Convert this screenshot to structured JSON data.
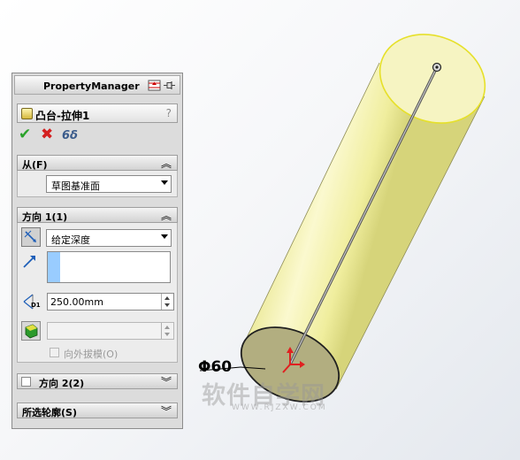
{
  "property_manager": {
    "title": "PropertyManager",
    "feature_name": "凸台-拉伸1",
    "help": "?",
    "actions": {
      "ok": "✔",
      "cancel": "✖",
      "preview": "6δ"
    },
    "from_group": {
      "label": "从(F)",
      "selected": "草图基准面"
    },
    "direction1_group": {
      "label": "方向 1(1)",
      "end_condition": "给定深度",
      "depth_icon_label": "D1",
      "depth_value": "250.00mm",
      "draft_value": "",
      "draft_outward_label": "向外拔模(O)"
    },
    "direction2_group": {
      "label": "方向 2(2)"
    },
    "selected_contours_group": {
      "label": "所选轮廓(S)"
    }
  },
  "viewport": {
    "dimension_label": "Φ60",
    "watermark": "软件自学网",
    "watermark_sub": "WWW.RJZXW.COM",
    "colors": {
      "cylinder_body": "#f4f2b8",
      "cylinder_edge": "#e6e02a",
      "bottom_face": "#b2ae80"
    }
  }
}
